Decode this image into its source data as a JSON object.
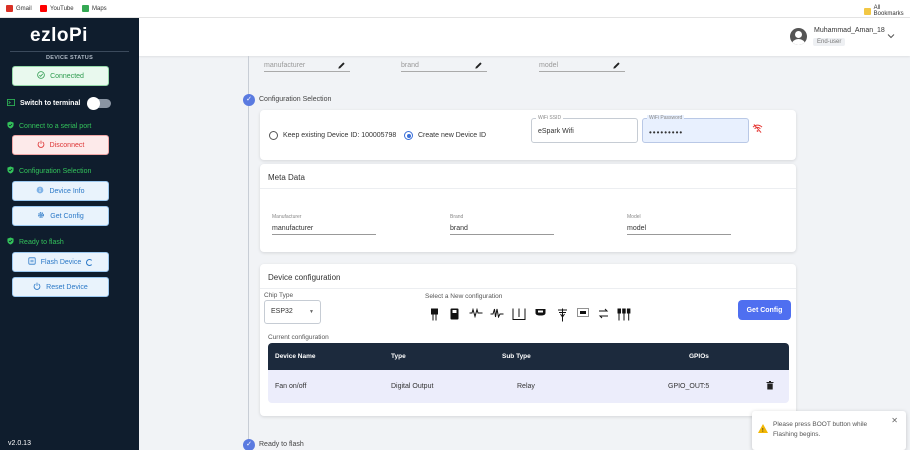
{
  "bookmarks": {
    "items": [
      {
        "label": "Gmail",
        "color": "#d93025"
      },
      {
        "label": "YouTube",
        "color": "#ff0000"
      },
      {
        "label": "Maps",
        "color": "#34a853"
      }
    ],
    "all": "All Bookmarks"
  },
  "sidebar": {
    "logo": "ezloPi",
    "device_status": "DEVICE STATUS",
    "connected_label": "Connected",
    "switch_label": "Switch to terminal",
    "serial_label": "Connect to a serial port",
    "disconnect_label": "Disconnect",
    "config_selection_label": "Configuration Selection",
    "device_info_label": "Device Info",
    "get_config_label": "Get Config",
    "ready_label": "Ready to flash",
    "flash_label": "Flash Device",
    "reset_label": "Reset Device",
    "version": "v2.0.13"
  },
  "header": {
    "user_name": "Muhammad_Aman_18",
    "user_role": "End-user"
  },
  "top_fields": {
    "manufacturer": "manufacturer",
    "brand": "brand",
    "model": "model"
  },
  "config_selection": {
    "step_label": "Configuration Selection",
    "keep_existing": "Keep existing Device ID: 100005798",
    "create_new": "Create new Device ID",
    "wifi_ssid_label": "WiFi SSID",
    "wifi_ssid_value": "eSpark Wifi",
    "wifi_password_label": "WiFi Password",
    "wifi_password_value": "•••••••••"
  },
  "meta_data": {
    "title": "Meta Data",
    "manufacturer_label": "Manufacturer",
    "manufacturer_value": "manufacturer",
    "brand_label": "Brand",
    "brand_value": "brand",
    "model_label": "Model",
    "model_value": "model"
  },
  "device_config": {
    "title": "Device configuration",
    "chip_type_label": "Chip Type",
    "chip_type_value": "ESP32",
    "select_new_label": "Select a New configuration",
    "get_config_button": "Get Config",
    "current_label": "Current configuration",
    "columns": [
      "Device Name",
      "Type",
      "Sub Type",
      "GPIOs"
    ],
    "rows": [
      {
        "device_name": "Fan on/off",
        "type": "Digital Output",
        "sub_type": "Relay",
        "gpios": "GPIO_OUT:5"
      }
    ]
  },
  "ready_step": "Ready to flash",
  "toast": {
    "message": "Please press BOOT button while Flashing begins."
  },
  "colors": {
    "sidebar_bg": "#0f1d2d",
    "accent": "#4f6ff0",
    "success": "#33c35b",
    "danger": "#d33333",
    "table_header": "#1c2a3d"
  }
}
